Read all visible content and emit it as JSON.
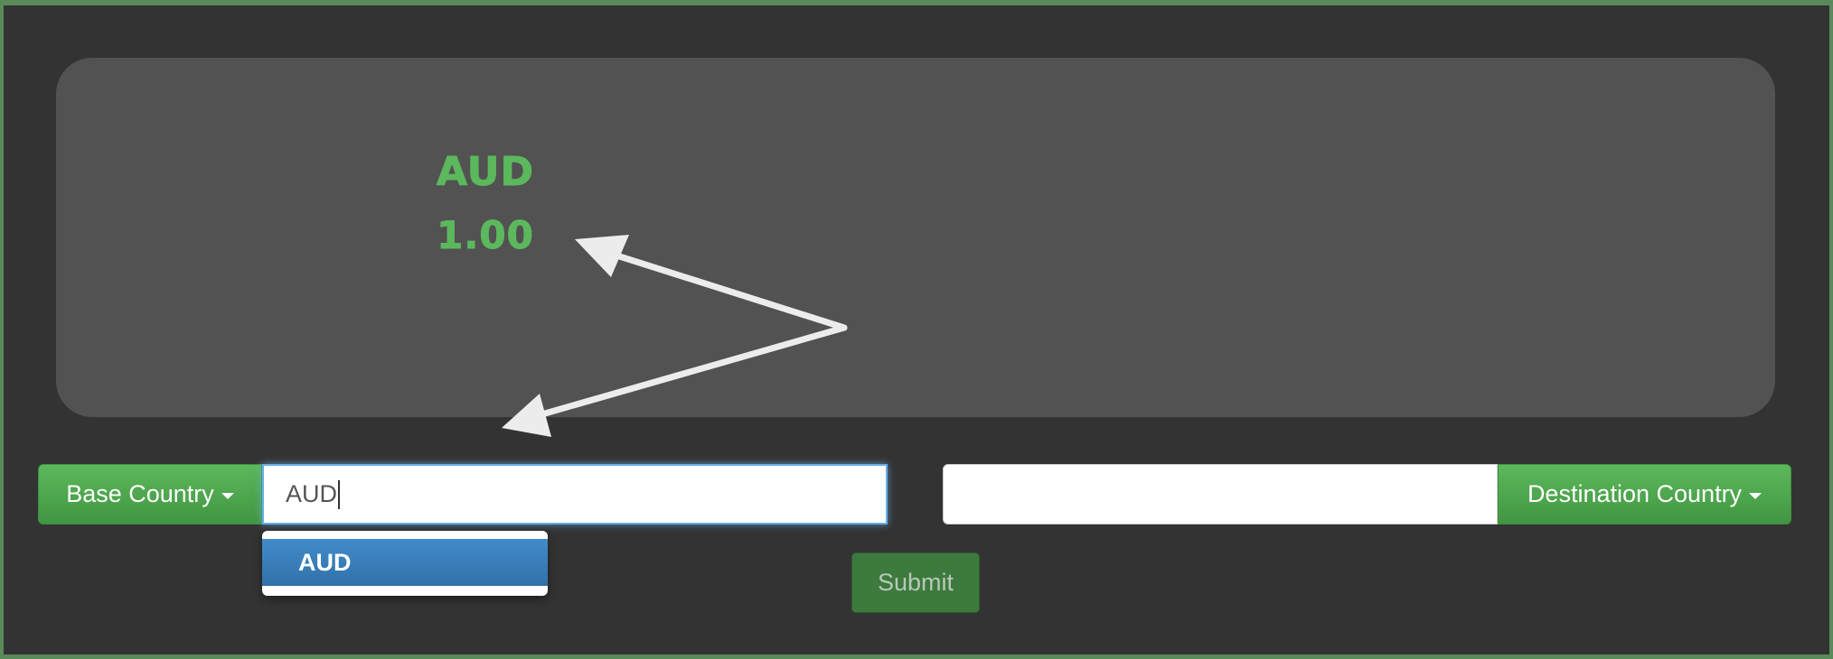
{
  "display": {
    "currency_code": "AUD",
    "currency_value": "1.00"
  },
  "base": {
    "button_label": "Base Country",
    "input_value": "AUD",
    "suggestions": [
      "AUD"
    ]
  },
  "destination": {
    "button_label": "Destination Country",
    "input_value": ""
  },
  "submit_label": "Submit",
  "colors": {
    "accent_green": "#5cb85c",
    "highlight_blue": "#428bca",
    "background": "#333333",
    "panel": "#525252"
  }
}
